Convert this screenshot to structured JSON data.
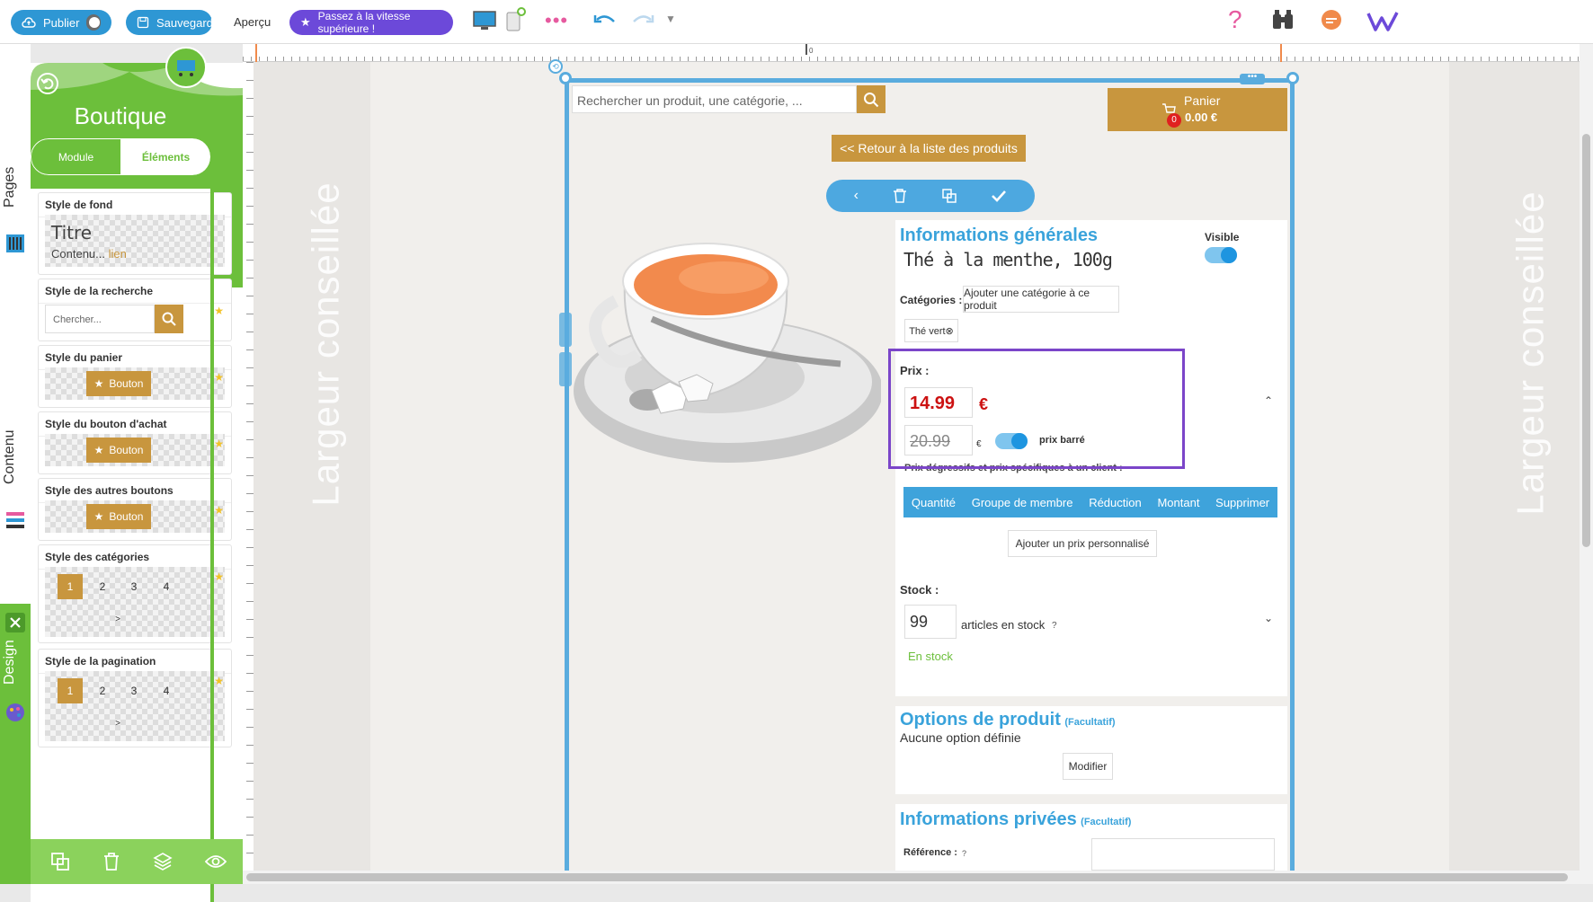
{
  "toolbar": {
    "publish_label": "Publier",
    "save_label": "Sauvegarder",
    "preview_label": "Aperçu",
    "upgrade_label": "Passez à la vitesse supérieure !",
    "colors": {
      "blue": "#2e97d4",
      "purple": "#6c49d9",
      "pink": "#e65a9f",
      "orange": "#f08a4b"
    }
  },
  "ruler": {
    "zero_label": "0"
  },
  "side_tabs": {
    "pages": "Pages",
    "content": "Contenu",
    "design": "Design"
  },
  "panel": {
    "title": "Boutique",
    "tabs": [
      {
        "label": "Module"
      },
      {
        "label": "Éléments"
      }
    ],
    "cards": {
      "background": {
        "title": "Style de fond",
        "sample_title": "Titre",
        "sample_content": "Contenu...",
        "sample_link": "lien"
      },
      "search": {
        "title": "Style de la recherche",
        "placeholder": "Chercher..."
      },
      "cart": {
        "title": "Style du panier",
        "button": "Bouton"
      },
      "buy": {
        "title": "Style du bouton d'achat",
        "button": "Bouton"
      },
      "other_buttons": {
        "title": "Style des autres boutons",
        "button": "Bouton"
      },
      "categories": {
        "title": "Style des catégories",
        "pages": [
          "1",
          "2",
          "3",
          "4"
        ],
        "next": ">"
      },
      "pagination": {
        "title": "Style de la pagination",
        "pages": [
          "1",
          "2",
          "3",
          "4"
        ],
        "next": ">"
      }
    }
  },
  "canvas": {
    "recommended_width": "Largeur conseillée",
    "search_placeholder": "Rechercher un produit, une catégorie, ...",
    "cart": {
      "label": "Panier",
      "amount": "0.00 €",
      "count": "0"
    },
    "back_label": "<< Retour à la liste des produits",
    "general": {
      "heading": "Informations générales",
      "product_name": "Thé à la menthe, 100g",
      "visible_label": "Visible",
      "categories_label": "Catégories :",
      "add_category": "Ajouter une catégorie à ce produit",
      "category_tag": "Thé vert⊗",
      "price_label": "Prix :",
      "price": "14.99",
      "currency": "€",
      "old_price": "20.99",
      "old_currency": "€",
      "strike_label": "prix barré",
      "tier_label": "Prix dégressifs et prix spécifiques à un client :",
      "tier_columns": [
        "Quantité",
        "Groupe de membre",
        "Réduction",
        "Montant",
        "Supprimer"
      ],
      "add_custom_price": "Ajouter un prix personnalisé",
      "stock_label": "Stock :",
      "stock_value": "99",
      "stock_unit": "articles en stock",
      "help": "?",
      "stock_status": "En stock"
    },
    "options": {
      "heading": "Options de produit",
      "optional": "(Facultatif)",
      "none": "Aucune option définie",
      "modify": "Modifier"
    },
    "private": {
      "heading": "Informations privées",
      "optional": "(Facultatif)",
      "reference_label": "Référence :",
      "help": "?"
    }
  }
}
